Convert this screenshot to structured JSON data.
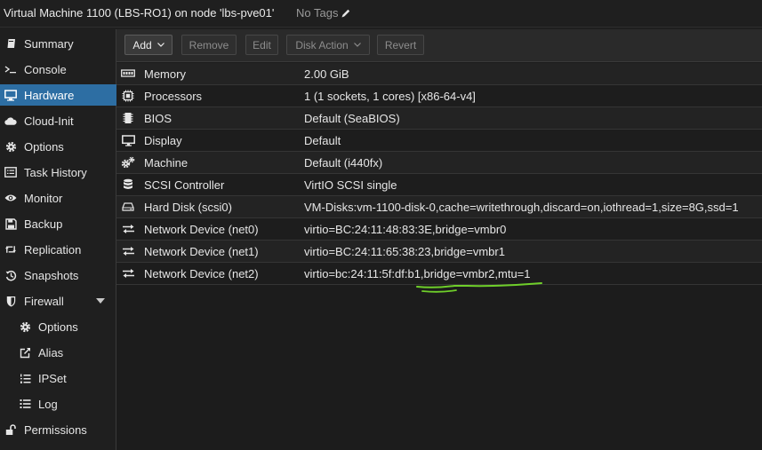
{
  "header": {
    "title": "Virtual Machine 1100 (LBS-RO1) on node 'lbs-pve01'",
    "tags_label": "No Tags",
    "tags_icon": "pencil-icon"
  },
  "sidebar": {
    "items": [
      {
        "label": "Summary",
        "icon": "book-icon"
      },
      {
        "label": "Console",
        "icon": "terminal-icon"
      },
      {
        "label": "Hardware",
        "icon": "desktop-icon",
        "active": true
      },
      {
        "label": "Cloud-Init",
        "icon": "cloud-icon"
      },
      {
        "label": "Options",
        "icon": "gear-icon"
      },
      {
        "label": "Task History",
        "icon": "list-alt-icon"
      },
      {
        "label": "Monitor",
        "icon": "eye-icon"
      },
      {
        "label": "Backup",
        "icon": "floppy-icon"
      },
      {
        "label": "Replication",
        "icon": "retweet-icon"
      },
      {
        "label": "Snapshots",
        "icon": "history-icon"
      },
      {
        "label": "Firewall",
        "icon": "shield-icon",
        "expanded": true
      },
      {
        "label": "Options",
        "icon": "gear-icon",
        "sub": true
      },
      {
        "label": "Alias",
        "icon": "external-link-icon",
        "sub": true
      },
      {
        "label": "IPSet",
        "icon": "list-numbered-icon",
        "sub": true
      },
      {
        "label": "Log",
        "icon": "list-icon",
        "sub": true
      },
      {
        "label": "Permissions",
        "icon": "unlock-icon"
      }
    ]
  },
  "toolbar": {
    "add_label": "Add",
    "remove_label": "Remove",
    "edit_label": "Edit",
    "disk_action_label": "Disk Action",
    "revert_label": "Revert"
  },
  "hardware": {
    "rows": [
      {
        "icon": "memory-icon",
        "name": "Memory",
        "value": "2.00 GiB"
      },
      {
        "icon": "cpu-icon",
        "name": "Processors",
        "value": "1 (1 sockets, 1 cores) [x86-64-v4]"
      },
      {
        "icon": "microchip-icon",
        "name": "BIOS",
        "value": "Default (SeaBIOS)"
      },
      {
        "icon": "monitor-icon",
        "name": "Display",
        "value": "Default"
      },
      {
        "icon": "cogs-icon",
        "name": "Machine",
        "value": "Default (i440fx)"
      },
      {
        "icon": "database-icon",
        "name": "SCSI Controller",
        "value": "VirtIO SCSI single"
      },
      {
        "icon": "hdd-icon",
        "name": "Hard Disk (scsi0)",
        "value": "VM-Disks:vm-1100-disk-0,cache=writethrough,discard=on,iothread=1,size=8G,ssd=1"
      },
      {
        "icon": "exchange-icon",
        "name": "Network Device (net0)",
        "value": "virtio=BC:24:11:48:83:3E,bridge=vmbr0"
      },
      {
        "icon": "exchange-icon",
        "name": "Network Device (net1)",
        "value": "virtio=BC:24:11:65:38:23,bridge=vmbr1"
      },
      {
        "icon": "exchange-icon",
        "name": "Network Device (net2)",
        "value": "virtio=bc:24:11:5f:df:b1,bridge=vmbr2,mtu=1"
      }
    ]
  },
  "colors": {
    "active": "#2d6ea3",
    "annotation": "#6fcf2a"
  }
}
